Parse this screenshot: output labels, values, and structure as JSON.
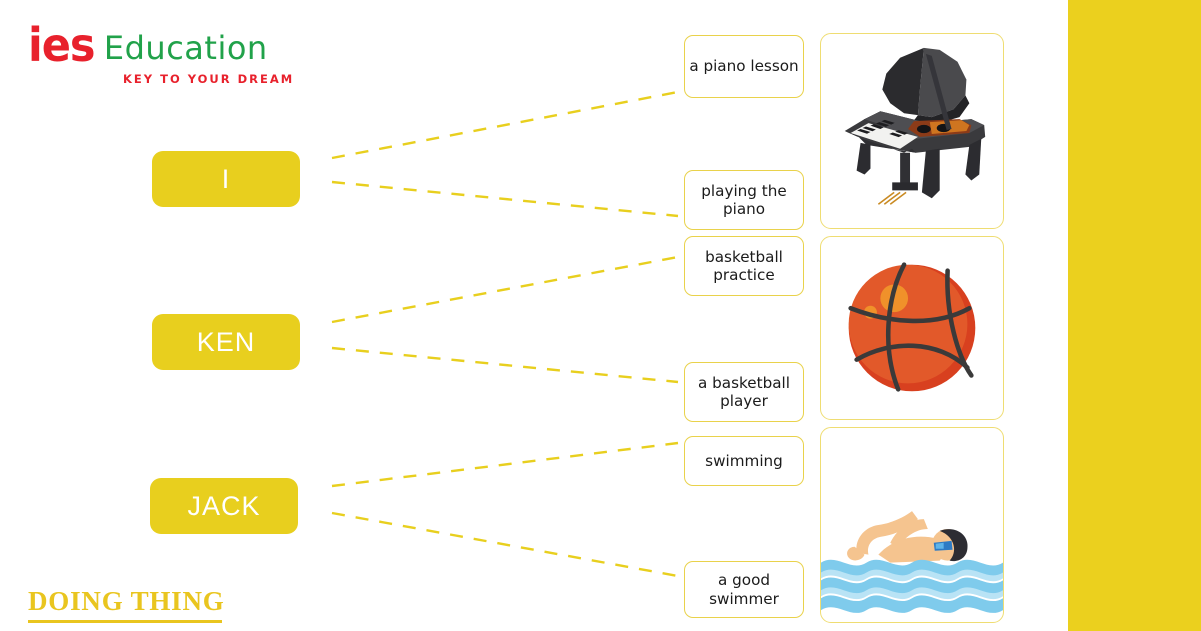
{
  "logo": {
    "mark": "ies",
    "word": "Education",
    "tagline": "KEY TO YOUR DREAM",
    "mark_color": "#E8212C",
    "word_color": "#21A24A",
    "tagline_color": "#E8212C"
  },
  "theme": {
    "yellow": "#E8CF1E",
    "panel_yellow": "#EBD01E",
    "box_border": "#E9D24B",
    "card_border": "#EFDD72",
    "line_color": "#E8CF1E",
    "footer_color": "#E9C51F"
  },
  "subjects": [
    {
      "id": "i",
      "label": "I"
    },
    {
      "id": "ken",
      "label": "KEN"
    },
    {
      "id": "jack",
      "label": "JACK"
    }
  ],
  "phrases": [
    {
      "id": "piano-lesson",
      "text": "a piano lesson"
    },
    {
      "id": "playing-piano",
      "text": "playing the piano"
    },
    {
      "id": "basketball-practice",
      "text": "basketball practice"
    },
    {
      "id": "basketball-player",
      "text": "a basketball player"
    },
    {
      "id": "swimming",
      "text": "swimming"
    },
    {
      "id": "good-swimmer",
      "text": "a good swimmer"
    }
  ],
  "cards": [
    {
      "id": "piano",
      "alt": "grand-piano-illustration"
    },
    {
      "id": "basketball",
      "alt": "basketball-illustration"
    },
    {
      "id": "swimming",
      "alt": "swimmer-illustration"
    }
  ],
  "connections": [
    {
      "from": "i",
      "to": "piano-lesson"
    },
    {
      "from": "i",
      "to": "playing-piano"
    },
    {
      "from": "ken",
      "to": "basketball-practice"
    },
    {
      "from": "ken",
      "to": "basketball-player"
    },
    {
      "from": "jack",
      "to": "swimming"
    },
    {
      "from": "jack",
      "to": "good-swimmer"
    }
  ],
  "footer": {
    "title": "DOING THING"
  }
}
